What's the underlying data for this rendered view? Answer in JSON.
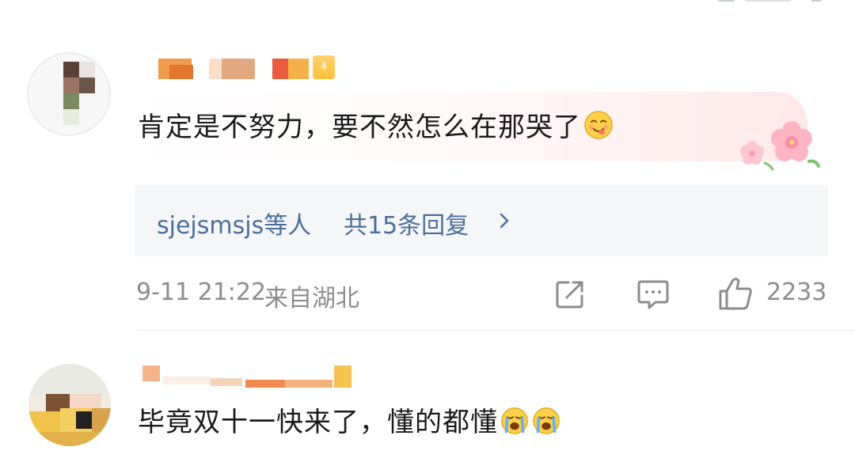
{
  "comments": [
    {
      "text": "肯定是不努力，要不然怎么在那哭了",
      "emoji": "yum-face-emoji",
      "level_badge": "4",
      "replies": {
        "users": "sjejsmsjs等人",
        "count_text": "共15条回复"
      },
      "time": "9-11 21:22",
      "location": "来自湖北",
      "like_count": "2233"
    },
    {
      "text": "毕竟双十一快来了，懂的都懂",
      "emojis": [
        "crying-face-emoji",
        "crying-face-emoji"
      ]
    }
  ],
  "icons": {
    "share": "share-icon",
    "comment": "comment-icon",
    "like": "thumbs-up-icon",
    "chevron": "chevron-right-icon",
    "decoration": "cherry-blossom-icon"
  },
  "colors": {
    "link_blue": "#4a6e9c",
    "meta_gray": "#8c8c8c",
    "text": "#1a1a1a",
    "reply_bg": "#f5f6f8",
    "badge_gold": "#ffbf3c"
  }
}
